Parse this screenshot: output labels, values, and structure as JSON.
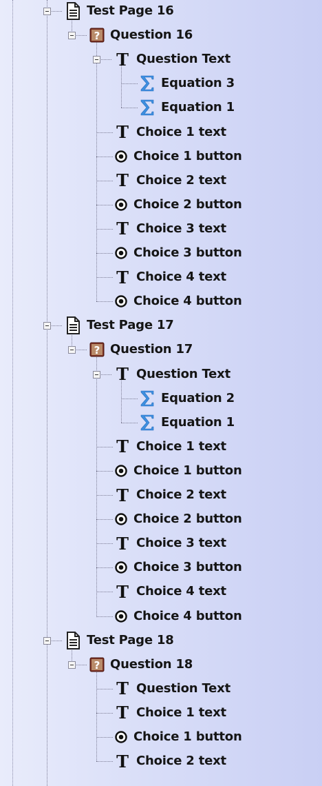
{
  "tree": [
    {
      "type": "page",
      "label": "Test Page 16",
      "children": [
        {
          "type": "question",
          "label": "Question 16",
          "children": [
            {
              "type": "text",
              "label": "Question Text",
              "expanded": true,
              "children": [
                {
                  "type": "equation",
                  "label": "Equation 3"
                },
                {
                  "type": "equation",
                  "label": "Equation 1"
                }
              ]
            },
            {
              "type": "text",
              "label": "Choice 1 text"
            },
            {
              "type": "radio",
              "label": "Choice 1 button"
            },
            {
              "type": "text",
              "label": "Choice 2 text"
            },
            {
              "type": "radio",
              "label": "Choice 2 button"
            },
            {
              "type": "text",
              "label": "Choice 3 text"
            },
            {
              "type": "radio",
              "label": "Choice 3 button"
            },
            {
              "type": "text",
              "label": "Choice 4 text"
            },
            {
              "type": "radio",
              "label": "Choice 4 button"
            }
          ]
        }
      ]
    },
    {
      "type": "page",
      "label": "Test Page 17",
      "children": [
        {
          "type": "question",
          "label": "Question 17",
          "children": [
            {
              "type": "text",
              "label": "Question Text",
              "expanded": true,
              "children": [
                {
                  "type": "equation",
                  "label": "Equation 2"
                },
                {
                  "type": "equation",
                  "label": "Equation 1"
                }
              ]
            },
            {
              "type": "text",
              "label": "Choice 1 text"
            },
            {
              "type": "radio",
              "label": "Choice 1 button"
            },
            {
              "type": "text",
              "label": "Choice 2 text"
            },
            {
              "type": "radio",
              "label": "Choice 2 button"
            },
            {
              "type": "text",
              "label": "Choice 3 text"
            },
            {
              "type": "radio",
              "label": "Choice 3 button"
            },
            {
              "type": "text",
              "label": "Choice 4 text"
            },
            {
              "type": "radio",
              "label": "Choice 4 button"
            }
          ]
        }
      ]
    },
    {
      "type": "page",
      "label": "Test Page 18",
      "children": [
        {
          "type": "question",
          "label": "Question 18",
          "children": [
            {
              "type": "text",
              "label": "Question Text"
            },
            {
              "type": "text",
              "label": "Choice 1 text"
            },
            {
              "type": "radio",
              "label": "Choice 1 button"
            },
            {
              "type": "text",
              "label": "Choice 2 text"
            }
          ]
        }
      ]
    }
  ],
  "colors": {
    "background_left": "#e9ecfb",
    "background_right": "#c9cff4",
    "sigma": "#3d8fe0",
    "question_icon": "#7a2f22",
    "text": "#151515"
  }
}
